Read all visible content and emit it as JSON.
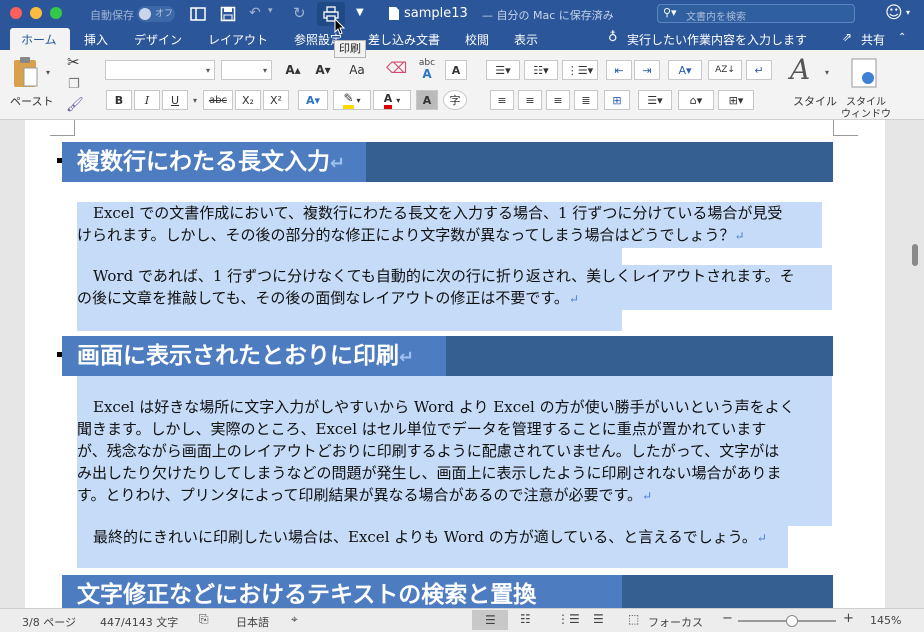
{
  "window": {
    "autosave": "自動保存",
    "autosave_toggle": "オフ",
    "title": "sample13",
    "title_suffix": "— 自分の Mac に保存済み",
    "search_placeholder": "文書内を検索",
    "tooltip": "印刷"
  },
  "tabs": [
    "ホーム",
    "挿入",
    "デザイン",
    "レイアウト",
    "参照設定",
    "差し込み文書",
    "校閲",
    "表示"
  ],
  "tell_me": "実行したい作業内容を入力します",
  "share": "共有",
  "ribbon": {
    "paste": "ペースト",
    "styles": "スタイル",
    "styles_pane_1": "スタイル",
    "styles_pane_2": "ウィンドウ",
    "bold": "B",
    "italic": "I",
    "underline": "U",
    "strike": "abc",
    "subscript": "X₂",
    "superscript": "X²",
    "font_size_up": "A▴",
    "font_size_down": "A▾",
    "change_case": "Aa",
    "char_shade": "A",
    "enclose": "字",
    "font_color": "A",
    "abc": "abc"
  },
  "doc": {
    "h1": "複数行にわたる長文入力",
    "p1a": "Excel での文書作成において、複数行にわたる長文を入力する場合、1 行ずつに分けている場合が見受",
    "p1b": "けられます。しかし、その後の部分的な修正により文字数が異なってしまう場合はどうでしょう？",
    "p2a": "Word であれば、1 行ずつに分けなくても自動的に次の行に折り返され、美しくレイアウトされます。そ",
    "p2b": "の後に文章を推敲しても、その後の面倒なレイアウトの修正は不要です。",
    "h2": "画面に表示されたとおりに印刷",
    "p3a": "Excel は好きな場所に文字入力がしやすいから Word より Excel の方が使い勝手がいいという声をよく",
    "p3b": "聞きます。しかし、実際のところ、Excel はセル単位でデータを管理することに重点が置かれています",
    "p3c": "が、残念ながら画面上のレイアウトどおりに印刷するように配慮されていません。したがって、文字がは",
    "p3d": "み出したり欠けたりしてしまうなどの問題が発生し、画面上に表示したように印刷されない場合がありま",
    "p3e": "す。とりわけ、プリンタによって印刷結果が異なる場合があるので注意が必要です。",
    "p4": "最終的にきれいに印刷したい場合は、Excel よりも Word の方が適している、と言えるでしょう。",
    "h3": "文字修正などにおけるテキストの検索と置換",
    "mark": "↵"
  },
  "status": {
    "page": "3/8 ページ",
    "words": "447/4143 文字",
    "lang": "日本語",
    "focus": "フォーカス",
    "zoom": "145%"
  }
}
